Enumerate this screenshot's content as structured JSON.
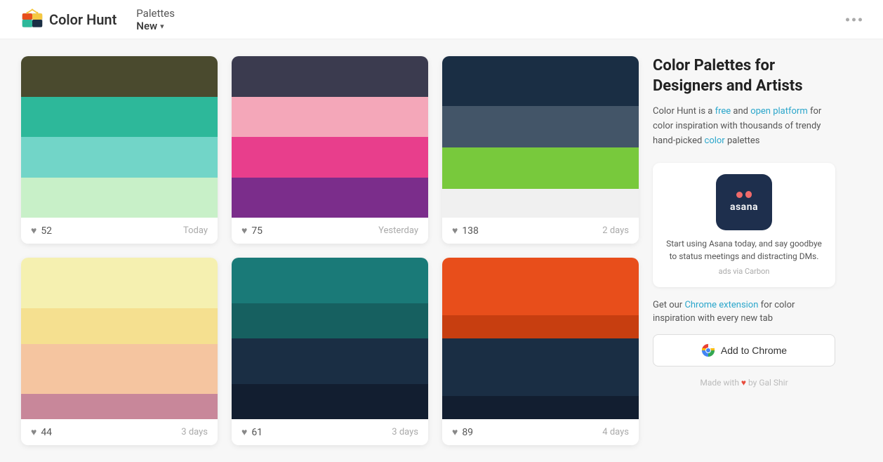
{
  "header": {
    "logo_text": "Color Hunt",
    "nav_palettes": "Palettes",
    "nav_new": "New"
  },
  "palettes": [
    {
      "id": "palette-1",
      "swatches": [
        "#4a4a2e",
        "#2db89a",
        "#72d5c8",
        "#c8f0c8"
      ],
      "likes": 52,
      "date": "Today"
    },
    {
      "id": "palette-2",
      "swatches": [
        "#3b3b4f",
        "#f4a7b9",
        "#e83e8c",
        "#7b2d8b"
      ],
      "likes": 75,
      "date": "Yesterday"
    },
    {
      "id": "palette-3",
      "swatches": [
        "#1a2e44",
        "#435568",
        "#78c93c",
        "#f0f0f0"
      ],
      "likes": 138,
      "date": "2 days"
    },
    {
      "id": "palette-4",
      "swatches": [
        "#f5f0b0",
        "#f5e090",
        "#f5c5a0",
        "#c8879a"
      ],
      "likes": 44,
      "date": "3 days"
    },
    {
      "id": "palette-5",
      "swatches": [
        "#1a7a78",
        "#1a7a78",
        "#1a2e44",
        "#1a2e44"
      ],
      "likes": 61,
      "date": "3 days"
    },
    {
      "id": "palette-6",
      "swatches": [
        "#e84e1b",
        "#e84e1b",
        "#1a2e44",
        "#1a2e44"
      ],
      "likes": 89,
      "date": "4 days"
    }
  ],
  "sidebar": {
    "title": "Color Palettes for Designers and Artists",
    "description_parts": [
      {
        "text": "Color Hunt is a ",
        "class": "normal"
      },
      {
        "text": "free",
        "class": "highlight"
      },
      {
        "text": " and ",
        "class": "normal"
      },
      {
        "text": "open platform",
        "class": "highlight"
      },
      {
        "text": " for color inspiration with thousands of trendy hand-picked ",
        "class": "normal"
      },
      {
        "text": "color",
        "class": "highlight-green"
      },
      {
        "text": " palettes",
        "class": "normal"
      }
    ],
    "ad": {
      "asana_name": "asana",
      "description": "Start using Asana today, and say goodbye to status meetings and distracting DMs.",
      "via": "ads via Carbon"
    },
    "chrome_ext": {
      "description_start": "Get our ",
      "chrome_link": "Chrome extension",
      "description_end": " for color inspiration with every new tab",
      "button_label": "Add to Chrome"
    },
    "footer": "Made with ♥ by Gal Shir"
  }
}
